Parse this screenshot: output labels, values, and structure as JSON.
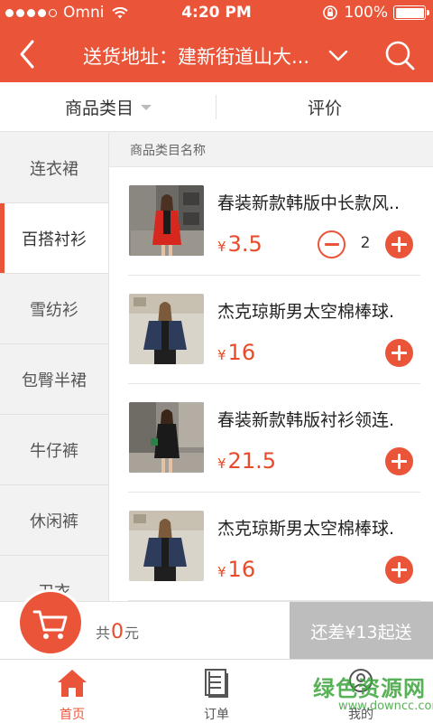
{
  "status_bar": {
    "carrier": "Omni",
    "time": "4:20 PM",
    "battery": "100%",
    "signal_filled": 4,
    "signal_total": 5
  },
  "header": {
    "title": "送货地址：建新街道山大...",
    "back_icon": "chevron-left-icon",
    "dropdown_icon": "chevron-down-icon",
    "search_icon": "search-icon"
  },
  "tabs": [
    {
      "label": "商品类目",
      "has_caret": true
    },
    {
      "label": "评价",
      "has_caret": false
    }
  ],
  "categories": [
    {
      "label": "连衣裙",
      "active": false
    },
    {
      "label": "百搭衬衫",
      "active": true
    },
    {
      "label": "雪纺衫",
      "active": false
    },
    {
      "label": "包臀半裙",
      "active": false
    },
    {
      "label": "牛仔裤",
      "active": false
    },
    {
      "label": "休闲裤",
      "active": false
    },
    {
      "label": "卫衣",
      "active": false
    }
  ],
  "section_header": "商品类目名称",
  "products": [
    {
      "name": "春装新款韩版中长款风..",
      "currency": "¥",
      "price": "3.5",
      "quantity": "2",
      "image": "woman-red-coat"
    },
    {
      "name": "杰克琼斯男太空棉棒球.",
      "currency": "¥",
      "price": "16",
      "quantity": "",
      "image": "woman-denim-jacket"
    },
    {
      "name": "春装新款韩版衬衫领连.",
      "currency": "¥",
      "price": "21.5",
      "quantity": "",
      "image": "woman-black-dress"
    },
    {
      "name": "杰克琼斯男太空棉棒球.",
      "currency": "¥",
      "price": "16",
      "quantity": "",
      "image": "woman-denim-jacket"
    }
  ],
  "cart": {
    "total_prefix": "共",
    "total_value": "0",
    "total_suffix": "元",
    "checkout_label": "还差¥13起送",
    "cart_icon": "cart-icon"
  },
  "tabbar": [
    {
      "label": "首页",
      "icon": "home-icon",
      "active": true
    },
    {
      "label": "订单",
      "icon": "order-list-icon",
      "active": false
    },
    {
      "label": "我的",
      "icon": "user-icon",
      "active": false
    }
  ],
  "watermark": {
    "text": "绿色资源网",
    "url": "www.downcc.com"
  },
  "colors": {
    "accent": "#ea5539",
    "price": "#e84a2a",
    "checkout_disabled": "#bdbdbd"
  }
}
